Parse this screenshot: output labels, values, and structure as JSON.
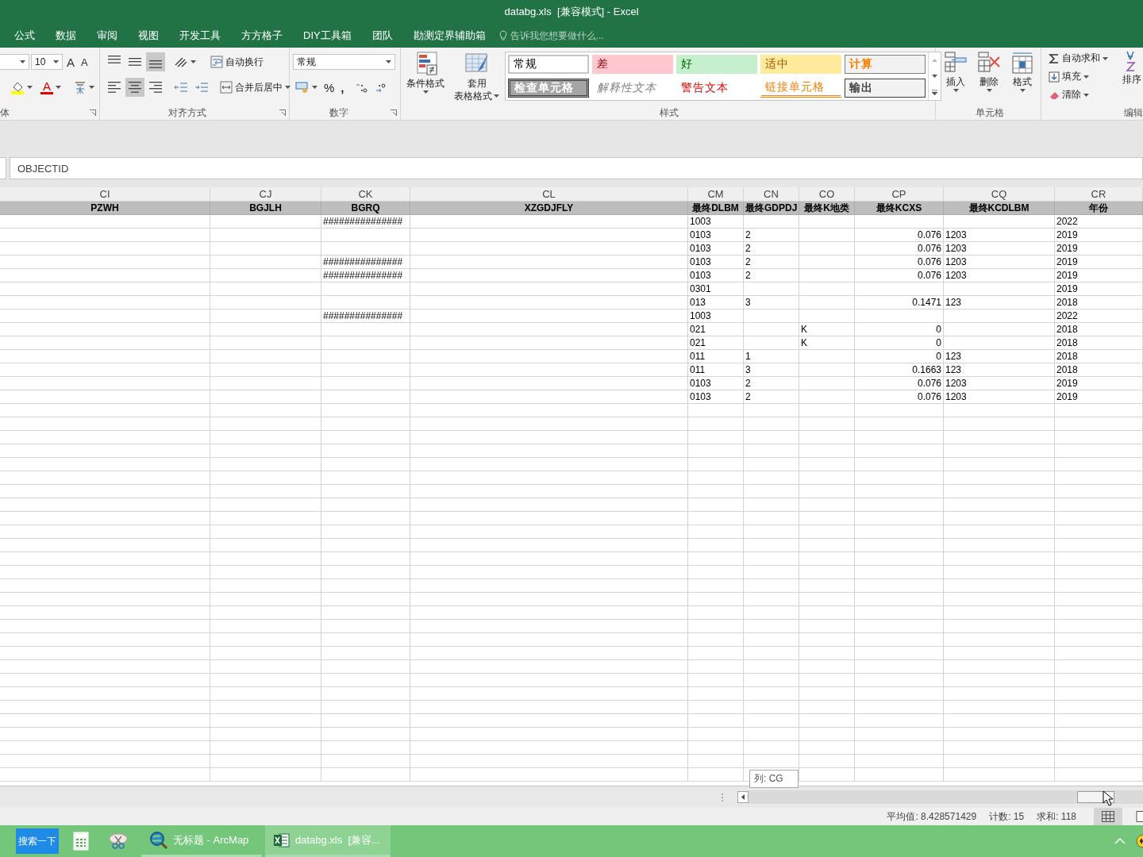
{
  "window": {
    "title": "databg.xls  [兼容模式] - Excel"
  },
  "menu_tabs": [
    "公式",
    "数据",
    "审阅",
    "视图",
    "开发工具",
    "方方格子",
    "DIY工具箱",
    "团队",
    "勘测定界辅助箱"
  ],
  "tell_me": {
    "placeholder": "告诉我您想要做什么..."
  },
  "ribbon": {
    "font": {
      "size": "10",
      "grow": "A",
      "shrink": "A",
      "font_color": "A",
      "label": "体"
    },
    "alignment": {
      "vertical": [
        {
          "selected": false
        },
        {
          "selected": false
        },
        {
          "selected": true
        }
      ],
      "horizontal": [
        {
          "selected": false
        },
        {
          "selected": true
        },
        {
          "selected": false
        }
      ],
      "wrap": "自动换行",
      "merge": "合并后居中",
      "label": "对齐方式"
    },
    "number": {
      "format": "常规",
      "percent": "%",
      "comma": ",",
      "label": "数字"
    },
    "styles": {
      "conditional": "条件格式",
      "table": [
        "套用",
        "表格格式"
      ],
      "cells": [
        {
          "label": "常规",
          "kind": "normal"
        },
        {
          "label": "差",
          "kind": "bad"
        },
        {
          "label": "好",
          "kind": "good"
        },
        {
          "label": "适中",
          "kind": "neutral"
        },
        {
          "label": "计算",
          "kind": "calc"
        },
        {
          "label": "检查单元格",
          "kind": "check"
        },
        {
          "label": "解释性文本",
          "kind": "explanatory"
        },
        {
          "label": "警告文本",
          "kind": "warning"
        },
        {
          "label": "链接单元格",
          "kind": "linked"
        },
        {
          "label": "输出",
          "kind": "output"
        }
      ],
      "label": "样式"
    },
    "cells": {
      "buttons": [
        {
          "label": "插入",
          "kind": "insert"
        },
        {
          "label": "删除",
          "kind": "delete"
        },
        {
          "label": "格式",
          "kind": "format"
        }
      ],
      "label": "单元格"
    },
    "editing": {
      "items": [
        {
          "label": "自动求和",
          "kind": "sum"
        },
        {
          "label": "填充",
          "kind": "fill"
        },
        {
          "label": "清除",
          "kind": "clear"
        }
      ],
      "sort": "排序",
      "label": "编辑"
    }
  },
  "formula_bar": {
    "value": "OBJECTID"
  },
  "sheet": {
    "columns": [
      {
        "letter": "CI",
        "field": "PZWH",
        "kind": "text"
      },
      {
        "letter": "CJ",
        "field": "BGJLH",
        "kind": "text"
      },
      {
        "letter": "CK",
        "field": "BGRQ",
        "kind": "text"
      },
      {
        "letter": "CL",
        "field": "XZGDJFLY",
        "kind": "text"
      },
      {
        "letter": "CM",
        "field": "最终DLBM",
        "kind": "text"
      },
      {
        "letter": "CN",
        "field": "最终GDPDJ",
        "kind": "text"
      },
      {
        "letter": "CO",
        "field": "最终K地类",
        "kind": "text"
      },
      {
        "letter": "CP",
        "field": "最终KCXS",
        "kind": "number"
      },
      {
        "letter": "CQ",
        "field": "最终KCDLBM",
        "kind": "text"
      },
      {
        "letter": "CR",
        "field": "年份",
        "kind": "text"
      }
    ],
    "rows": [
      {
        "CK": "###############",
        "CM": "1003",
        "CR": "2022"
      },
      {
        "CM": "0103",
        "CN": "2",
        "CP": "0.076",
        "CQ": "1203",
        "CR": "2019"
      },
      {
        "CM": "0103",
        "CN": "2",
        "CP": "0.076",
        "CQ": "1203",
        "CR": "2019"
      },
      {
        "CK": "###############",
        "CM": "0103",
        "CN": "2",
        "CP": "0.076",
        "CQ": "1203",
        "CR": "2019"
      },
      {
        "CK": "###############",
        "CM": "0103",
        "CN": "2",
        "CP": "0.076",
        "CQ": "1203",
        "CR": "2019"
      },
      {
        "CM": "0301",
        "CR": "2019"
      },
      {
        "CM": "013",
        "CN": "3",
        "CP": "0.1471",
        "CQ": "123",
        "CR": "2018"
      },
      {
        "CK": "###############",
        "CM": "1003",
        "CR": "2022"
      },
      {
        "CM": "021",
        "CO": "K",
        "CP": "0",
        "CR": "2018"
      },
      {
        "CM": "021",
        "CO": "K",
        "CP": "0",
        "CR": "2018"
      },
      {
        "CM": "011",
        "CN": "1",
        "CP": "0",
        "CQ": "123",
        "CR": "2018"
      },
      {
        "CM": "011",
        "CN": "3",
        "CP": "0.1663",
        "CQ": "123",
        "CR": "2018"
      },
      {
        "CM": "0103",
        "CN": "2",
        "CP": "0.076",
        "CQ": "1203",
        "CR": "2019"
      },
      {
        "CM": "0103",
        "CN": "2",
        "CP": "0.076",
        "CQ": "1203",
        "CR": "2019"
      }
    ]
  },
  "tooltip": "列: CG",
  "status_bar": {
    "average": "平均值: 8.428571429",
    "count": "计数: 15",
    "sum": "求和: 118"
  },
  "taskbar": {
    "search": "搜索一下",
    "windows": [
      {
        "label": "无标题 - ArcMap",
        "kind": "arcmap",
        "selected": false
      },
      {
        "label": "databg.xls  [兼容...",
        "kind": "excel",
        "selected": true
      }
    ]
  }
}
